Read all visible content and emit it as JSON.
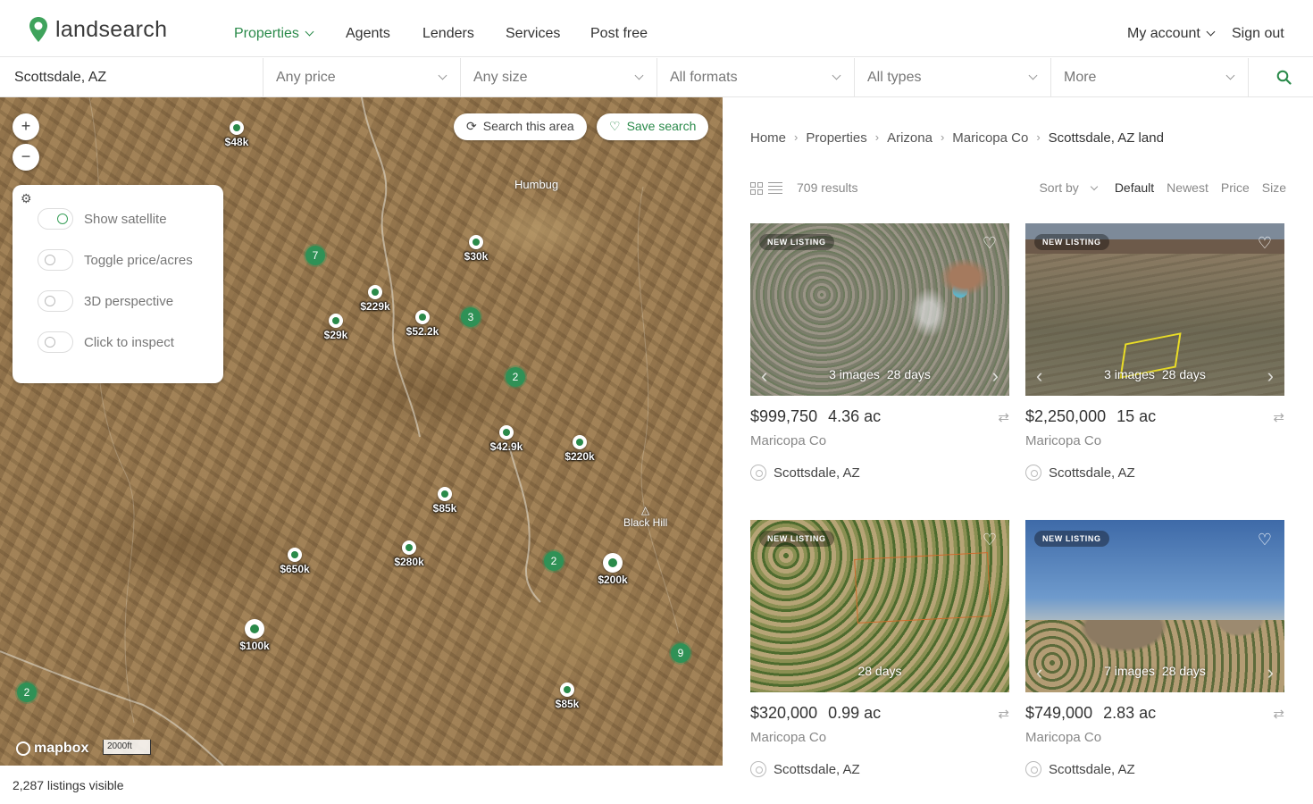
{
  "app": {
    "logo_text": "landsearch"
  },
  "nav": {
    "items": [
      {
        "label": "Properties",
        "active": true
      },
      {
        "label": "Agents"
      },
      {
        "label": "Lenders"
      },
      {
        "label": "Services"
      },
      {
        "label": "Post free"
      }
    ],
    "account": "My account",
    "signout": "Sign out"
  },
  "filters": {
    "location": "Scottsdale, AZ",
    "price": "Any price",
    "size": "Any size",
    "formats": "All formats",
    "types": "All types",
    "more": "More"
  },
  "map": {
    "zoom_in": "+",
    "zoom_out": "−",
    "search_area": "Search this area",
    "save_search": "Save search",
    "settings": [
      {
        "label": "Show satellite",
        "on": true
      },
      {
        "label": "Toggle price/acres",
        "on": false
      },
      {
        "label": "3D perspective",
        "on": false
      },
      {
        "label": "Click to inspect",
        "on": false
      }
    ],
    "places": {
      "humbug": "Humbug",
      "black_hill": "Black Hill"
    },
    "pins": [
      "$48k",
      "$30k",
      "$229k",
      "$29k",
      "$52.2k",
      "$42.9k",
      "$220k",
      "$85k",
      "$650k",
      "$280k",
      "$200k",
      "$100k",
      "$85k"
    ],
    "clusters": [
      "7",
      "3",
      "2",
      "2",
      "9",
      "2"
    ],
    "attribution": "mapbox",
    "scale": "2000ft",
    "visible_count": "2,287 listings visible"
  },
  "results": {
    "breadcrumb": [
      "Home",
      "Properties",
      "Arizona",
      "Maricopa Co",
      "Scottsdale, AZ land"
    ],
    "count": "709 results",
    "sort_label": "Sort by",
    "sort_options": [
      "Default",
      "Newest",
      "Price",
      "Size"
    ],
    "listings": [
      {
        "badge": "NEW LISTING",
        "images": "3 images",
        "days": "28 days",
        "price": "$999,750",
        "acres": "4.36 ac",
        "county": "Maricopa Co",
        "city": "Scottsdale, AZ"
      },
      {
        "badge": "NEW LISTING",
        "images": "3 images",
        "days": "28 days",
        "price": "$2,250,000",
        "acres": "15 ac",
        "county": "Maricopa Co",
        "city": "Scottsdale, AZ"
      },
      {
        "badge": "NEW LISTING",
        "images": "",
        "days": "28 days",
        "price": "$320,000",
        "acres": "0.99 ac",
        "county": "Maricopa Co",
        "city": "Scottsdale, AZ"
      },
      {
        "badge": "NEW LISTING",
        "images": "7 images",
        "days": "28 days",
        "price": "$749,000",
        "acres": "2.83 ac",
        "county": "Maricopa Co",
        "city": "Scottsdale, AZ"
      }
    ]
  },
  "colors": {
    "brand_green": "#2a8a4a",
    "cluster_green": "#2f9156"
  }
}
